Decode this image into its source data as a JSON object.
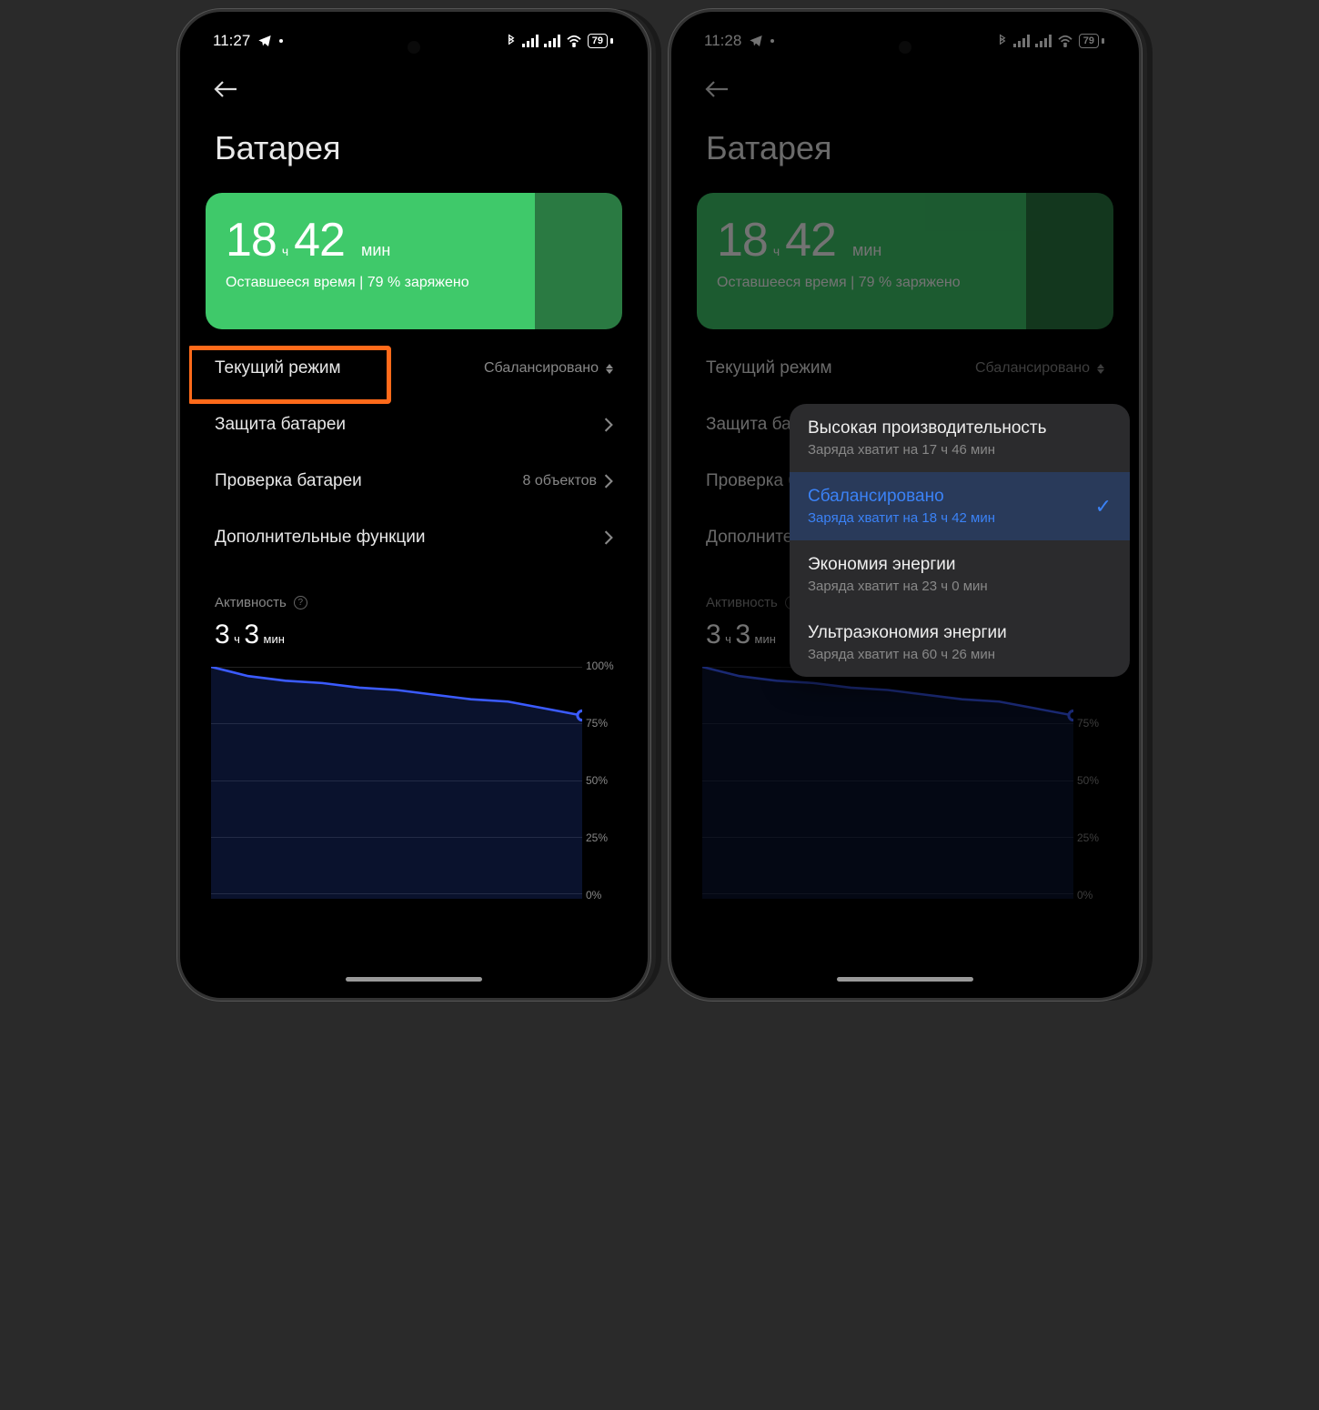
{
  "phones": [
    {
      "time": "11:27",
      "battery_pct": "79"
    },
    {
      "time": "11:28",
      "battery_pct": "79"
    }
  ],
  "page_title": "Батарея",
  "battery_card": {
    "hours": "18",
    "hours_unit": "ч",
    "minutes": "42",
    "minutes_unit": "мин",
    "subtitle": "Оставшееся время | 79 % заряжено"
  },
  "rows": {
    "mode_label": "Текущий режим",
    "mode_value": "Сбалансировано",
    "protect_label": "Защита батареи",
    "check_label": "Проверка батареи",
    "check_value": "8 объектов",
    "extra_label": "Дополнительные функции"
  },
  "activity": {
    "label": "Активность",
    "hours": "3",
    "hours_unit": "ч",
    "minutes": "3",
    "minutes_unit": "мин"
  },
  "chart_data": {
    "type": "area",
    "ylabel": "%",
    "ylim": [
      0,
      100
    ],
    "y_ticks": [
      "100%",
      "75%",
      "50%",
      "25%",
      "0%"
    ],
    "x": [
      0,
      0.1,
      0.2,
      0.3,
      0.4,
      0.5,
      0.6,
      0.7,
      0.8,
      0.9,
      1.0
    ],
    "values": [
      100,
      96,
      94,
      93,
      91,
      90,
      88,
      86,
      85,
      82,
      79
    ]
  },
  "popup": {
    "items": [
      {
        "title": "Высокая производительность",
        "sub": "Заряда хватит на 17 ч 46 мин",
        "selected": false
      },
      {
        "title": "Сбалансировано",
        "sub": "Заряда хватит на 18 ч 42 мин",
        "selected": true
      },
      {
        "title": "Экономия энергии",
        "sub": "Заряда хватит на 23 ч 0 мин",
        "selected": false
      },
      {
        "title": "Ультраэкономия энергии",
        "sub": "Заряда хватит на 60 ч 26 мин",
        "selected": false
      }
    ]
  }
}
